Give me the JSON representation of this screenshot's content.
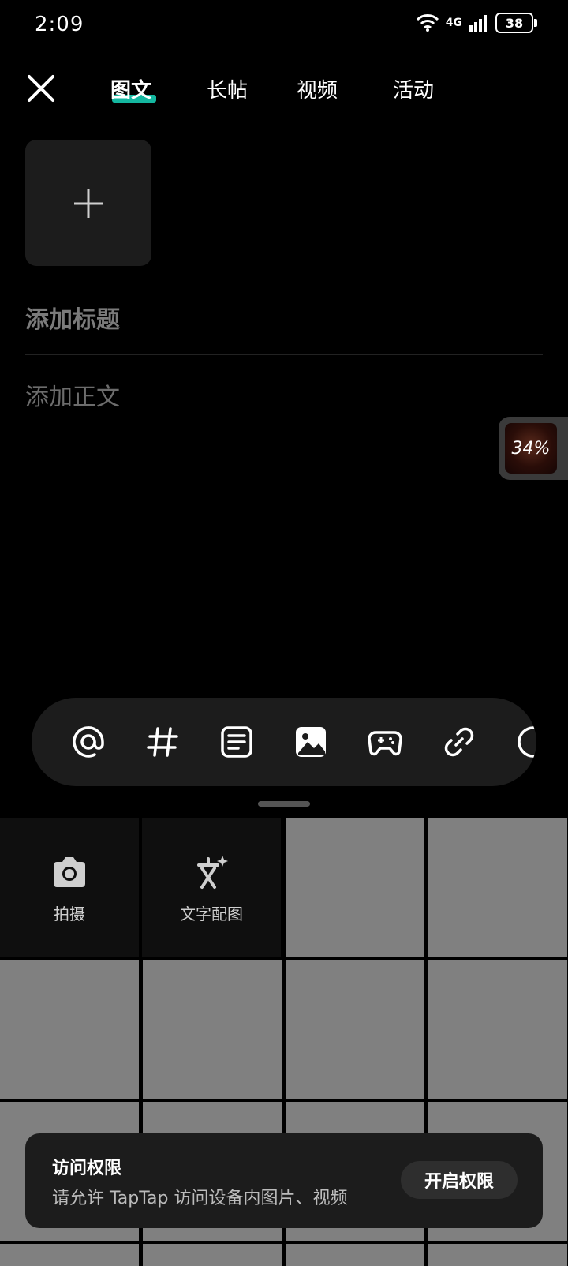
{
  "status": {
    "time": "2:09",
    "network": "4G",
    "battery": "38"
  },
  "tabs": [
    {
      "label": "图文"
    },
    {
      "label": "长帖"
    },
    {
      "label": "视频"
    },
    {
      "label": "活动"
    }
  ],
  "editor": {
    "title_placeholder": "添加标题",
    "body_placeholder": "添加正文"
  },
  "floating_widget": {
    "percent": "34%"
  },
  "toolbar": {
    "icons": [
      "at-icon",
      "hashtag-icon",
      "text-block-icon",
      "image-icon",
      "gamepad-icon",
      "link-icon",
      "more-icon"
    ]
  },
  "gallery": {
    "camera_label": "拍摄",
    "text_image_label": "文字配图"
  },
  "permission": {
    "title": "访问权限",
    "description": "请允许 TapTap 访问设备内图片、视频",
    "button": "开启权限"
  },
  "colors": {
    "accent": "#14b7a0",
    "panel": "#1c1c1c",
    "placeholder_tile": "#808080"
  }
}
